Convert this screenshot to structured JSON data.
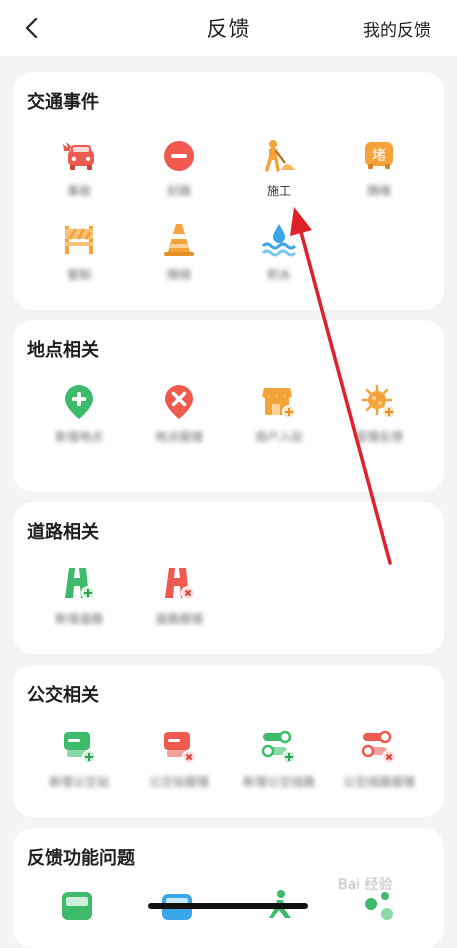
{
  "header": {
    "title": "反馈",
    "my_feedback": "我的反馈"
  },
  "sections": {
    "traffic": {
      "title": "交通事件",
      "items": [
        {
          "label": "事故",
          "icon": "accident-car-icon"
        },
        {
          "label": "封路",
          "icon": "road-closed-icon"
        },
        {
          "label": "施工",
          "icon": "construction-worker-icon"
        },
        {
          "label": "拥堵",
          "icon": "traffic-jam-icon"
        },
        {
          "label": "管制",
          "icon": "barrier-icon"
        },
        {
          "label": "障碍",
          "icon": "traffic-cone-icon"
        },
        {
          "label": "积水",
          "icon": "water-icon"
        }
      ],
      "jam_glyph": "堵"
    },
    "place": {
      "title": "地点相关",
      "items": [
        {
          "label": "新增地点",
          "icon": "add-place-icon"
        },
        {
          "label": "地点报错",
          "icon": "place-error-icon"
        },
        {
          "label": "商户入驻",
          "icon": "shop-add-icon"
        },
        {
          "label": "疫情反馈",
          "icon": "virus-add-icon"
        }
      ]
    },
    "road": {
      "title": "道路相关",
      "items": [
        {
          "label": "新增道路",
          "icon": "add-road-icon"
        },
        {
          "label": "道路报错",
          "icon": "road-error-icon"
        }
      ]
    },
    "bus": {
      "title": "公交相关",
      "items": [
        {
          "label": "新增公交站",
          "icon": "add-bus-stop-icon"
        },
        {
          "label": "公交站报错",
          "icon": "bus-stop-error-icon"
        },
        {
          "label": "新增公交线路",
          "icon": "add-bus-line-icon"
        },
        {
          "label": "公交线路报错",
          "icon": "bus-line-error-icon"
        }
      ]
    },
    "feedback": {
      "title": "反馈功能问题"
    }
  },
  "colors": {
    "red": "#ef5a4f",
    "orange": "#f4a23a",
    "green": "#3dbb6b",
    "blue": "#3aa5e8",
    "arrow": "#e0202a"
  },
  "watermark": "Bai 经验"
}
